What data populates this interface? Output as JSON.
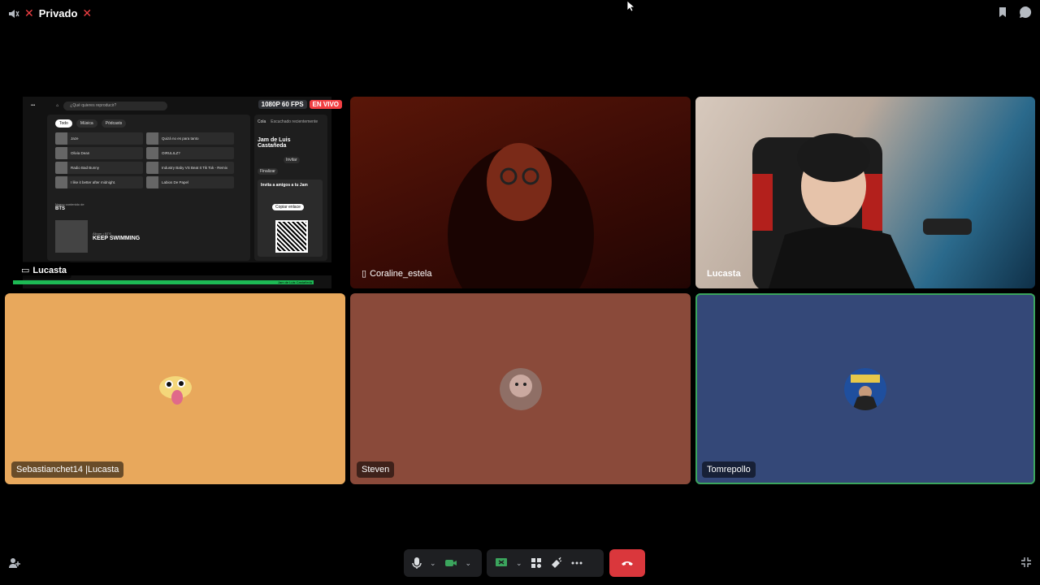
{
  "header": {
    "channel_name": "Privado"
  },
  "tiles": [
    {
      "name": "Lucasta",
      "type": "stream",
      "badges": {
        "quality": "1080P 60 FPS",
        "live": "EN VIVO"
      }
    },
    {
      "name": "Coraline_estela",
      "type": "video"
    },
    {
      "name": "Lucasta",
      "type": "video"
    },
    {
      "name": "Sebastianchet14 |Lucasta",
      "type": "avatar"
    },
    {
      "name": "Steven",
      "type": "avatar"
    },
    {
      "name": "Tomrepollo",
      "type": "avatar"
    }
  ],
  "stream": {
    "search_placeholder": "¿Qué quieres reproducir?",
    "chips": [
      "Todo",
      "Música",
      "Pódcasts"
    ],
    "cards": [
      "Jaze",
      "Quizá no es para tanto",
      "Olivia Dean",
      "OIRULILZ?",
      "Radio Bad Bunny",
      "Industry Baby VS Beat It Tik Tok - Remix",
      "I like it better after midnight.",
      "Labios De Papel"
    ],
    "section_label": "Nuevo contenido de",
    "section_artist": "BTS",
    "album_label": "Álbum • BTS",
    "album_title": "KEEP SWIMMING",
    "right_tabs": [
      "Cola",
      "Escuchado recientemente"
    ],
    "jam_title": "Jam de Luis Castañeda",
    "invite_label": "Invitar",
    "finish_label": "Finalizar",
    "invite_panel_title": "Invita a amigos a tu Jam",
    "copy_link": "Copiar enlace",
    "jam_bar": "Jam de Luis Castañeda"
  },
  "toolbar": {
    "mic": "microphone-icon",
    "camera": "camera-icon",
    "screen_share": "screen-share-icon",
    "activities": "activities-icon",
    "soundboard": "soundboard-icon",
    "more": "more-icon",
    "hangup": "hangup-icon"
  },
  "colors": {
    "accent_green": "#3ba55d",
    "hangup_red": "#da373c",
    "live_red": "#f23f43",
    "tile_orange": "#e8a85c",
    "tile_brown": "#8a4a3a",
    "tile_blue": "#344878"
  }
}
